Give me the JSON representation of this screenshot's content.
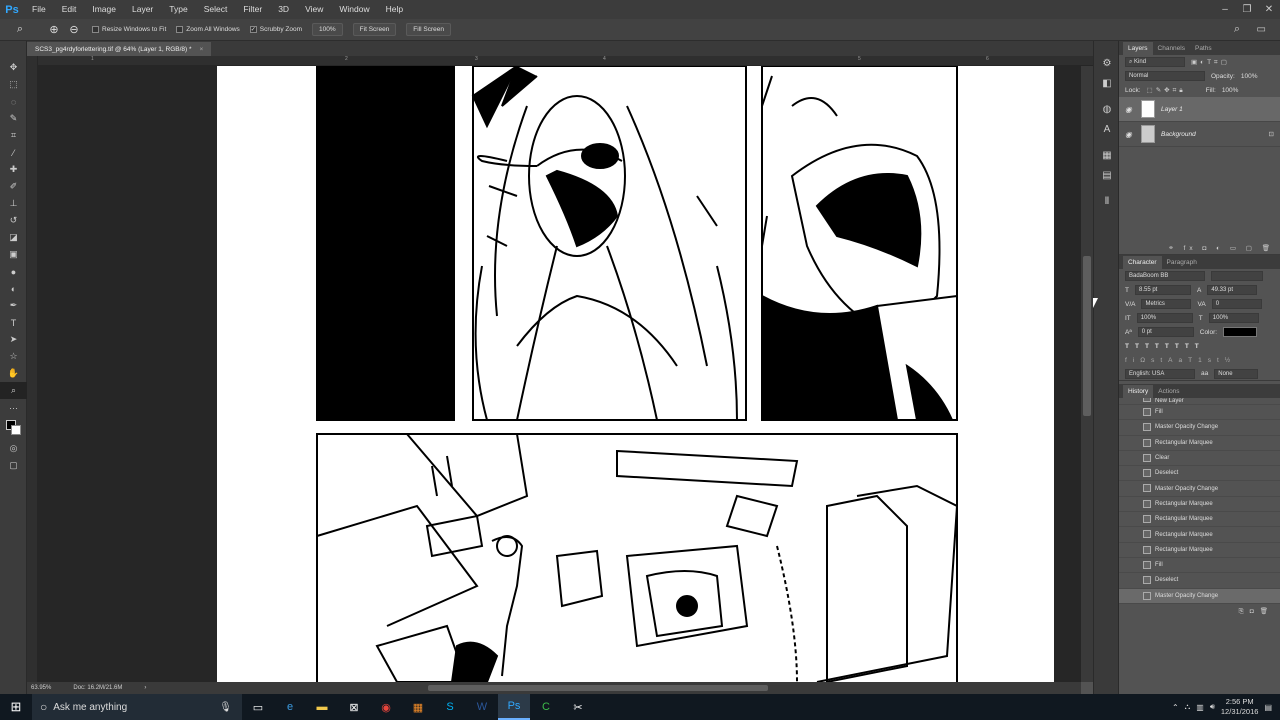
{
  "menu": {
    "items": [
      "File",
      "Edit",
      "Image",
      "Layer",
      "Type",
      "Select",
      "Filter",
      "3D",
      "View",
      "Window",
      "Help"
    ]
  },
  "options": {
    "resize_windows": "Resize Windows to Fit",
    "zoom_all": "Zoom All Windows",
    "scrubby_zoom": "Scrubby Zoom",
    "zoom_value": "100%",
    "fit_screen": "Fit Screen",
    "fill_screen": "Fill Screen"
  },
  "document": {
    "tab_title": "SCS3_pg4rdyforlettering.tif @ 64% (Layer 1, RGB/8) *"
  },
  "ruler": {
    "marks": [
      "1",
      "2",
      "3",
      "4",
      "5",
      "6"
    ]
  },
  "status": {
    "zoom": "63.95%",
    "doc_size": "Doc: 16.2M/21.6M"
  },
  "layers_panel": {
    "tabs": [
      "Layers",
      "Channels",
      "Paths"
    ],
    "filter_label": "Kind",
    "blend_mode": "Normal",
    "opacity_label": "Opacity:",
    "opacity_value": "100%",
    "lock_label": "Lock:",
    "fill_label": "Fill:",
    "fill_value": "100%",
    "layers": [
      {
        "name": "Layer 1",
        "selected": true
      },
      {
        "name": "Background",
        "selected": false
      }
    ]
  },
  "character_panel": {
    "tabs": [
      "Character",
      "Paragraph"
    ],
    "font": "BadaBoom BB",
    "size": "8.55 pt",
    "leading": "49.33 pt",
    "kerning": "Metrics",
    "tracking": "0",
    "vscale": "100%",
    "hscale": "100%",
    "baseline": "0 pt",
    "color_label": "Color:",
    "language": "English: USA",
    "anti_alias": "None"
  },
  "history_panel": {
    "tabs": [
      "History",
      "Actions"
    ],
    "items": [
      "New Layer",
      "Fill",
      "Master Opacity Change",
      "Rectangular Marquee",
      "Clear",
      "Deselect",
      "Master Opacity Change",
      "Rectangular Marquee",
      "Rectangular Marquee",
      "Rectangular Marquee",
      "Rectangular Marquee",
      "Fill",
      "Deselect",
      "Master Opacity Change"
    ]
  },
  "taskbar": {
    "search_placeholder": "Ask me anything",
    "time": "2:56 PM",
    "date": "12/31/2016"
  }
}
